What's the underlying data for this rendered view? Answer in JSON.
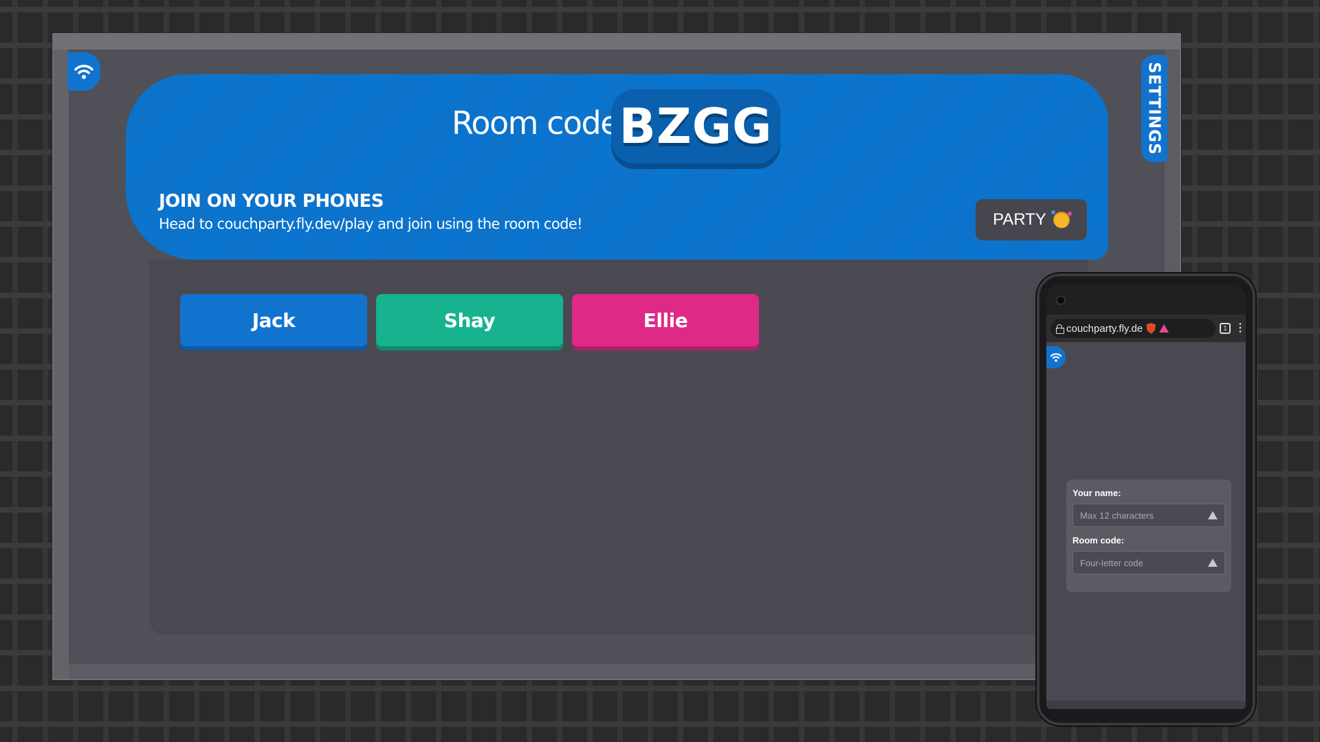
{
  "header": {
    "room_label": "Room code:",
    "room_code": "BZGG",
    "join_title": "JOIN ON YOUR PHONES",
    "join_text": "Head to couchparty.fly.dev/play and join using the room code!",
    "party_label": "PARTY"
  },
  "settings_label": "SETTINGS",
  "players": [
    {
      "name": "Jack",
      "color": "#1273cf"
    },
    {
      "name": "Shay",
      "color": "#16b38e"
    },
    {
      "name": "Ellie",
      "color": "#de2a86"
    }
  ],
  "phone": {
    "url": "couchparty.fly.de",
    "tab_count": "1",
    "name_label": "Your name:",
    "name_placeholder": "Max 12 characters",
    "code_label": "Room code:",
    "code_placeholder": "Four-letter code"
  },
  "icons": [
    "wifi-icon",
    "party-emoji-icon",
    "lock-icon",
    "brave-shield-icon",
    "warning-icon",
    "tabs-icon",
    "menu-icon"
  ],
  "colors": {
    "accent": "#1273cf",
    "banner": "#0b74ce",
    "room_code_bg": "#0a60ad"
  }
}
